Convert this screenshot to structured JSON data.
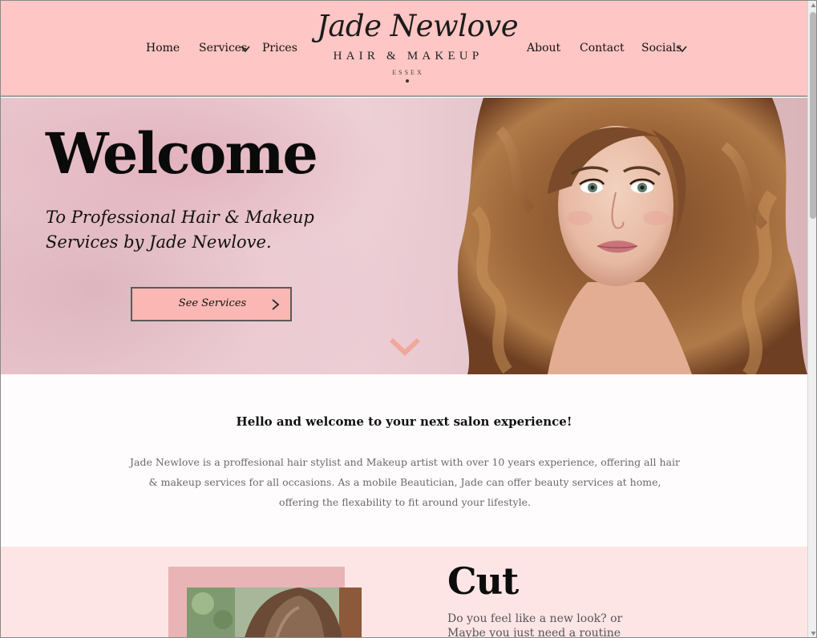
{
  "nav": {
    "left": [
      {
        "label": "Home"
      },
      {
        "label": "Services"
      },
      {
        "label": "Prices"
      }
    ],
    "right": [
      {
        "label": "About"
      },
      {
        "label": "Contact"
      },
      {
        "label": "Socials"
      }
    ]
  },
  "logo": {
    "name": "Jade Newlove",
    "tagline": "Hair & Makeup",
    "location": "Essex"
  },
  "hero": {
    "title": "Welcome",
    "subtitle": "To Professional Hair & Makeup Services by Jade Newlove.",
    "button_label": "See Services"
  },
  "intro": {
    "heading": "Hello and welcome to your next salon experience!",
    "body": "Jade Newlove is a proffesional hair stylist and Makeup artist with over 10 years experience, offering all hair & makeup services for all occasions. As a mobile Beautician, Jade can offer beauty services at home, offering the flexability to fit around your lifestyle."
  },
  "cut": {
    "title": "Cut",
    "text": "Do you feel like a new look? or Maybe you just need a routine trim up? Well"
  },
  "colors": {
    "header_bg": "#fec6c4",
    "button_bg": "#fbb7b3",
    "accent_chevron": "#f0a89b",
    "section_bg": "#fde5e6"
  },
  "icons": {
    "services_dropdown": "chevron-down-icon",
    "socials_dropdown": "chevron-down-icon",
    "button_arrow": "chevron-right-icon",
    "scroll_hint": "chevron-down-icon"
  }
}
